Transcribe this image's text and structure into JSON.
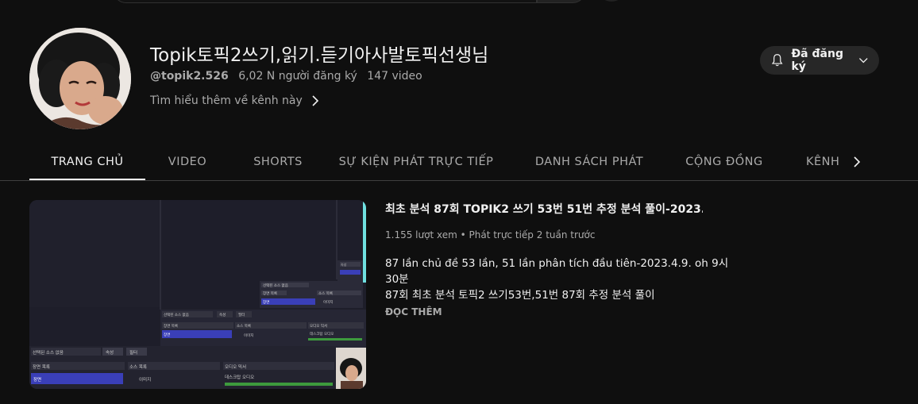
{
  "channel": {
    "name": "Topik토픽2쓰기,읽기.듣기아사발토픽선생님",
    "handle": "@topik2.526",
    "subscribers": "6,02 N người đăng ký",
    "videos": "147 video",
    "more_link": "Tìm hiểu thêm về kênh này",
    "subscribe_label": "Đã đăng ký"
  },
  "tabs": [
    {
      "label": "TRANG CHỦ",
      "active": true
    },
    {
      "label": "VIDEO",
      "active": false
    },
    {
      "label": "SHORTS",
      "active": false
    },
    {
      "label": "SỰ KIỆN PHÁT TRỰC TIẾP",
      "active": false
    },
    {
      "label": "DANH SÁCH PHÁT",
      "active": false
    },
    {
      "label": "CỘNG ĐỒNG",
      "active": false
    },
    {
      "label": "KÊNH",
      "active": false
    }
  ],
  "featured_video": {
    "title": "최초 분석 87회 TOPIK2 쓰기 53번 51번 추정 분석 풀이-2023.4.9. ...",
    "views": "1.155 lượt xem",
    "time": "Phát trực tiếp 2 tuần trước",
    "description_lines": [
      "87 lần chủ đề 53 lần, 51 lần phân tích đầu tiên-2023.4.9. oh 9시",
      "30분",
      "87회 최초 분석 토픽2 쓰기53번,51번 87회 추정 분석 풀이"
    ],
    "read_more": "ĐỌC THÊM"
  },
  "thumbnail": {
    "panel_labels": {
      "scene_sources_small": "선택된 소스 없음",
      "properties_small": "속성",
      "filters_small": "필터",
      "scenes_small": "장면 목록",
      "scene_item_small": "장면",
      "sources_small": "소스 목록",
      "source_item_small": "이미지",
      "audio_small": "오디오 믹서",
      "desktop_audio_small": "데스크탑 오디오",
      "scene_sources": "선택된 소스 없음",
      "properties": "속성",
      "filters": "필터",
      "scenes": "장면 목록",
      "scene_item": "장면",
      "sources": "소스 목록",
      "source_item": "이미지",
      "audio": "오디오 믹서",
      "desktop_audio": "데스크탑 오디오"
    }
  },
  "colors": {
    "background": "#0f0f0f",
    "text_primary": "#f1f1f1",
    "text_secondary": "#aaaaaa",
    "button_bg": "#272727",
    "obs_highlight": "#3a3fb8"
  }
}
